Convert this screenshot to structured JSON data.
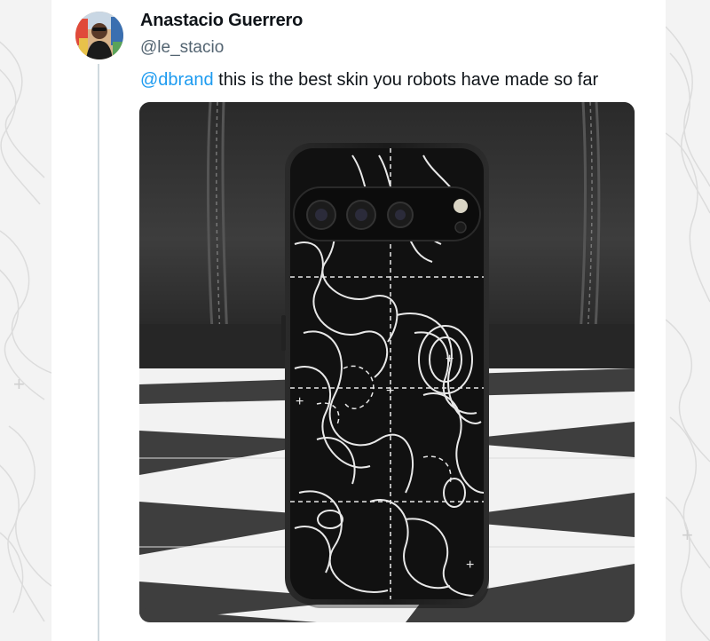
{
  "tweet": {
    "author": {
      "display_name": "Anastacio Guerrero",
      "handle": "@le_stacio",
      "avatar_icon": "user-avatar"
    },
    "text": {
      "mention": "@dbrand",
      "body": " this is the best skin you robots have made so far"
    },
    "media": {
      "icon": "phone-photo",
      "alt": ""
    }
  },
  "colors": {
    "mention": "#1d9bf0",
    "name": "#0f1419",
    "handle": "#536471",
    "thread_line": "#cfd9de"
  }
}
